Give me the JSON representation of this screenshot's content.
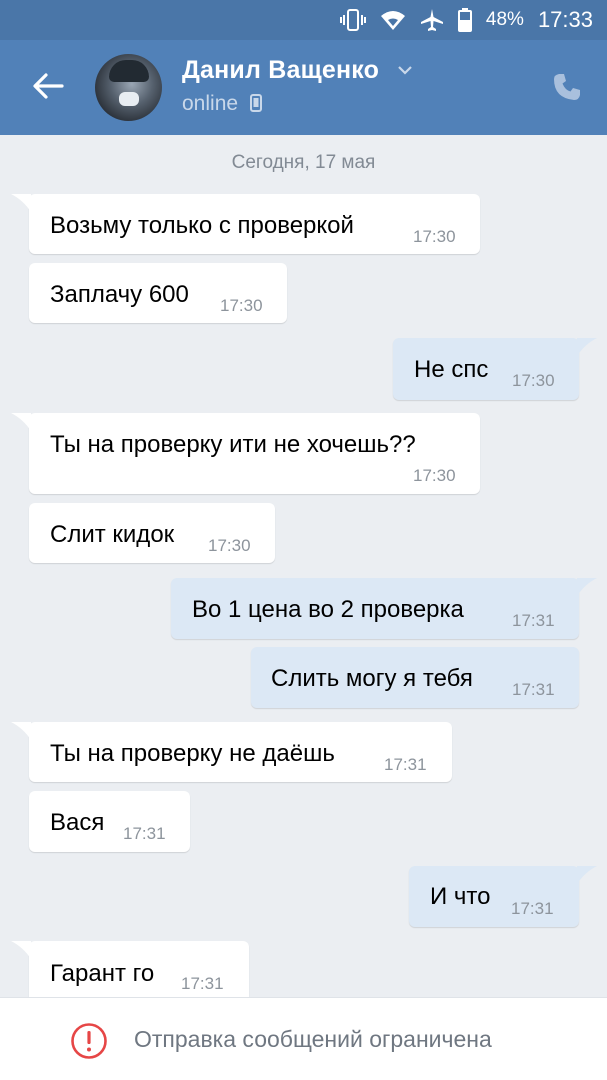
{
  "status_bar": {
    "battery": "48%",
    "time": "17:33",
    "icons": [
      "vibrate-icon",
      "wifi-icon",
      "airplane-icon",
      "battery-icon"
    ]
  },
  "header": {
    "contact_name": "Данил Ващенко",
    "status": "online",
    "icons": [
      "back-arrow-icon",
      "chevron-down-icon",
      "mobile-device-icon",
      "phone-icon"
    ]
  },
  "chat": {
    "date_separator": "Сегодня, 17 мая",
    "messages": [
      {
        "dir": "in",
        "text": "Возьму только с проверкой",
        "time": "17:30"
      },
      {
        "dir": "in",
        "text": "Заплачу 600",
        "time": "17:30"
      },
      {
        "dir": "out",
        "text": "Не спс",
        "time": "17:30"
      },
      {
        "dir": "in",
        "text": "Ты на проверку ити не хочешь??",
        "time": "17:30"
      },
      {
        "dir": "in",
        "text": "Слит кидок",
        "time": "17:30"
      },
      {
        "dir": "out",
        "text": "Во 1 цена во 2 проверка",
        "time": "17:31"
      },
      {
        "dir": "out",
        "text": "Слить могу я тебя",
        "time": "17:31"
      },
      {
        "dir": "in",
        "text": "Ты на проверку не даёшь",
        "time": "17:31"
      },
      {
        "dir": "in",
        "text": "Вася",
        "time": "17:31"
      },
      {
        "dir": "out",
        "text": "И что",
        "time": "17:31"
      },
      {
        "dir": "in",
        "text": "Гарант го",
        "time": "17:31"
      }
    ]
  },
  "footer": {
    "notice": "Отправка сообщений ограничена",
    "icon": "warning-icon"
  },
  "colors": {
    "header_bg": "#5181b8",
    "incoming_bubble": "#ffffff",
    "outgoing_bubble": "#dce8f5",
    "chat_bg": "#ebeef2",
    "warning": "#e64646"
  }
}
